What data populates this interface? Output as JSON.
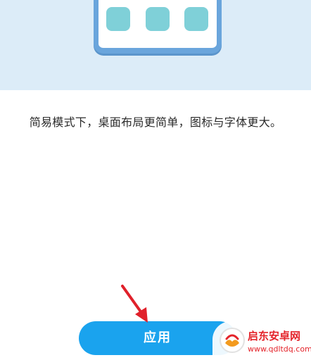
{
  "illustration": {
    "icon": "simple-mode-phone-illustration",
    "tile_color": "#7fd0d8",
    "frame_color": "#6aa5dc"
  },
  "description": "简易模式下，桌面布局更简单，图标与字体更大。",
  "apply_button": {
    "label": "应用",
    "color": "#1aa3ee"
  },
  "annotation": {
    "icon": "red-arrow-icon",
    "color": "#e0202a"
  },
  "watermark": {
    "title": "启东安卓网",
    "url": "www.qdltdq.com"
  }
}
